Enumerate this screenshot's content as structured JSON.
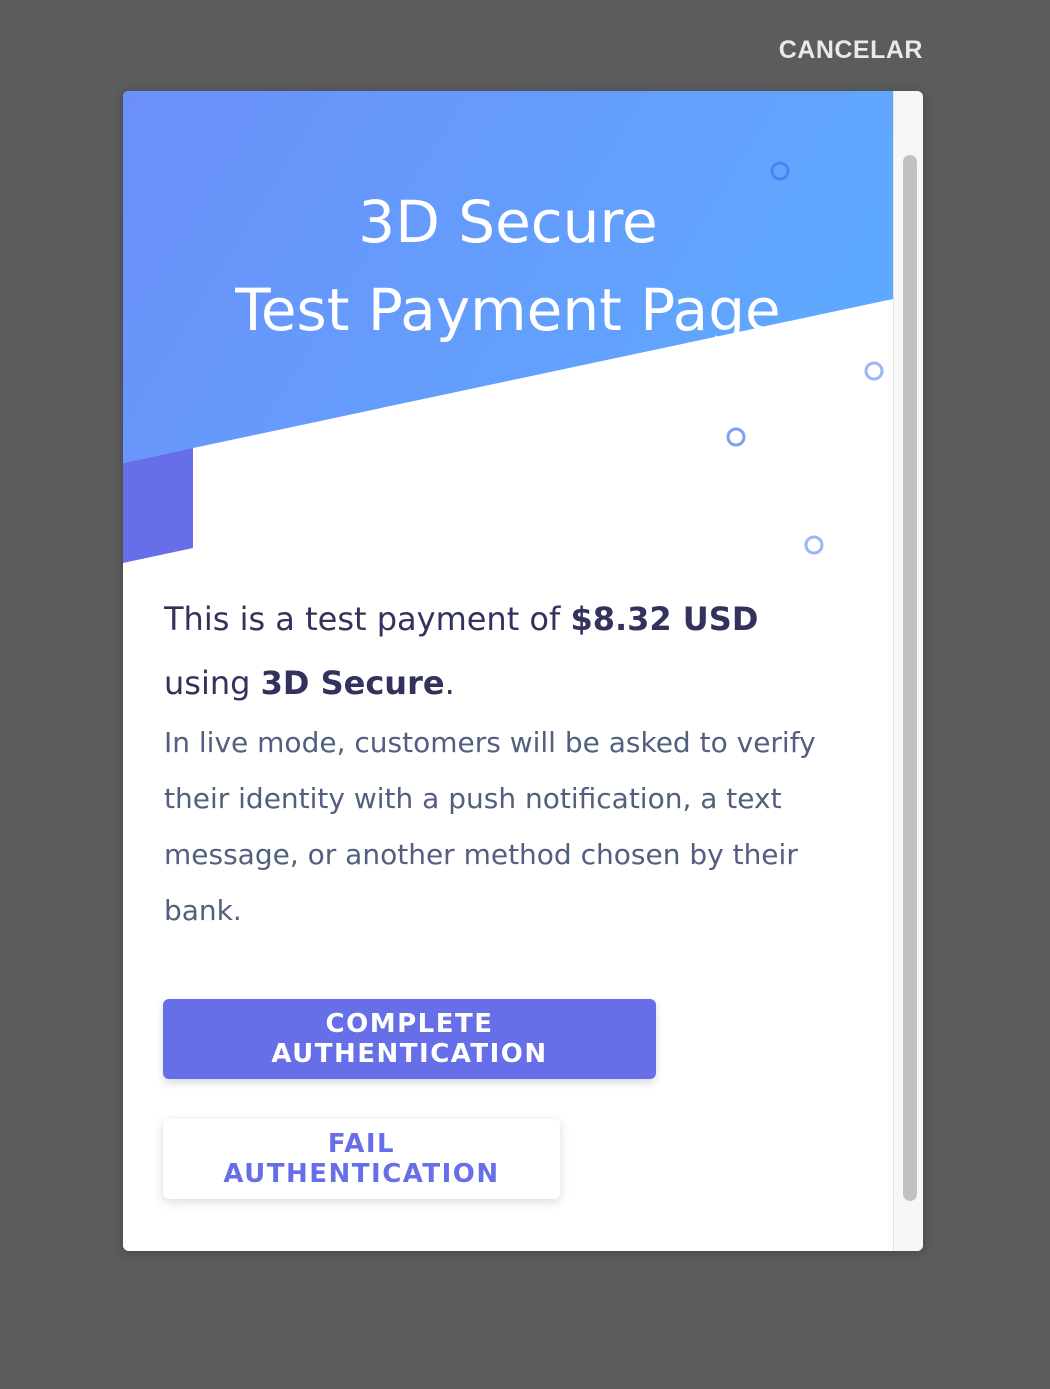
{
  "top_bar": {
    "cancel_label": "CANCELAR"
  },
  "banner": {
    "title_line1": "3D Secure",
    "title_line2": "Test Payment Page"
  },
  "message": {
    "prefix": "This is a test payment of ",
    "amount": "$8.32 USD",
    "middle": "using ",
    "method": "3D Secure",
    "suffix": ".",
    "description": "In live mode, customers will be asked to verify their identity with a push notification, a text message, or another method chosen by their bank."
  },
  "actions": {
    "complete_label": "COMPLETE AUTHENTICATION",
    "fail_label": "FAIL AUTHENTICATION"
  },
  "colors": {
    "overlay": "#5c5c5c",
    "banner_gradient_start": "#6b8ff9",
    "banner_gradient_end": "#5fa8ff",
    "accent": "#666ee8",
    "heading_text": "#32325d",
    "body_text": "#525f7f"
  }
}
